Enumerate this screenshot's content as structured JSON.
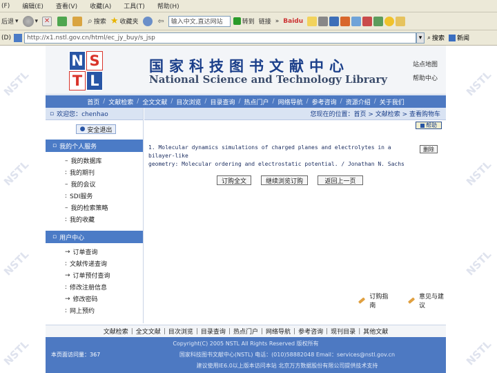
{
  "browser": {
    "menu": [
      "(F)",
      "编辑(E)",
      "查看(V)",
      "收藏(A)",
      "工具(T)",
      "帮助(H)"
    ],
    "toolbar": {
      "back_label": "后退",
      "search_label": "搜索",
      "favorites_label": "收藏夹",
      "search_input_placeholder": "输入中文,直达网站",
      "go_label": "转到",
      "links_label": "链接",
      "baidu_label": "Baidu"
    },
    "address": {
      "label": "(D)",
      "url": "http://x1.nstl.gov.cn/html/ec_jy_buy/s_jsp"
    },
    "search_btn": "搜索",
    "news_label": "新闻"
  },
  "site": {
    "title_cn": "国家科技图书文献中心",
    "title_en": "National Science and Technology Library",
    "top_links": [
      "站点地图",
      "帮助中心"
    ],
    "nav": [
      "首页",
      "文献检索",
      "全文文献",
      "目次浏览",
      "目录查询",
      "热点门户",
      "网络导航",
      "参考咨询",
      "资源介绍",
      "关于我们"
    ],
    "welcome": "欢迎您：chenhao",
    "logout": "安全退出",
    "personal_section": "我的个人服务",
    "personal_items": [
      "我的数据库",
      "我的期刊",
      "我的会议",
      "SDI服务",
      "我的检索策略",
      "我的收藏"
    ],
    "center_section": "用户中心",
    "center_items": [
      "订单查询",
      "文献传递查询",
      "订单预付查询",
      "修改注册信息",
      "修改密码",
      "网上预约"
    ],
    "breadcrumb": "您现在的位置：首页 > 文献检索 > 查看购物车",
    "help": "帮助",
    "item_text_1": "1. Molecular dynamics simulations of charged planes and electrolytes in a bilayer-like",
    "item_text_2": "geometry: Molecular ordering and electrostatic potential. / Jonathan N. Sachs",
    "delete_btn": "删除",
    "actions": [
      "订购全文",
      "继续浏览订购",
      "返回上一页"
    ],
    "bottom_links": [
      "订购指南",
      "意见与建议"
    ],
    "footer_links": [
      "文献检索",
      "全文文献",
      "目次浏览",
      "目录查询",
      "热点门户",
      "网络导航",
      "参考咨询",
      "现刊目录",
      "其他文献"
    ],
    "visits": "本页面访问量：367",
    "copyright": "Copyright(C) 2005 NSTL All Rights Reserved 版权所有",
    "contact": "国家科技图书文献中心(NSTL) 电话：(010)58882048 Email：services@nstl.gov.cn",
    "footer_note": "建议使用IE6.0以上版本访问本站    北京万方数据股份有限公司提供技术支持",
    "watermark": "NSTL"
  },
  "colors": {
    "nav_blue": "#4d79c2",
    "header_bg": "#f3f5f8",
    "title_blue": "#1b3f8a",
    "logo_red": "#d9342b",
    "logo_blue": "#2855a5"
  }
}
